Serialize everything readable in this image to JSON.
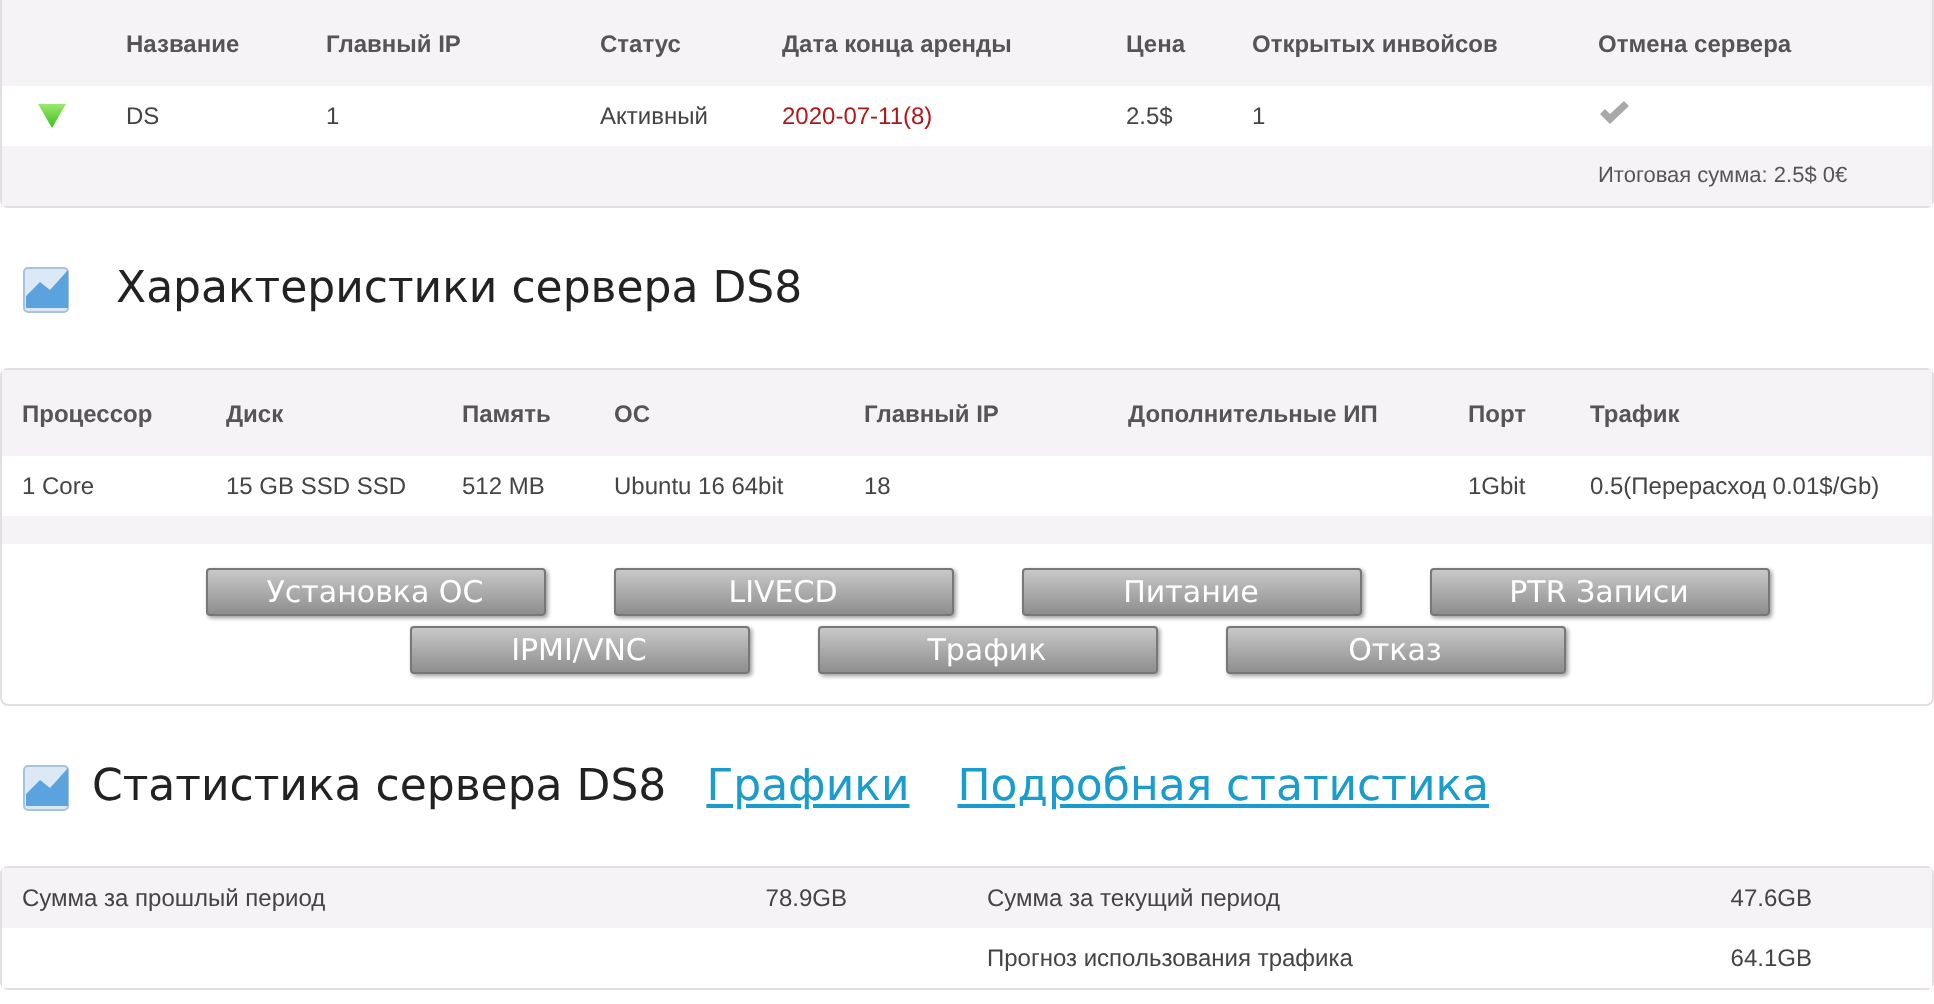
{
  "servers_table": {
    "columns": [
      "Название",
      "Главный IP",
      "Статус",
      "Дата конца аренды",
      "Цена",
      "Открытых инвойсов",
      "Отмена сервера"
    ],
    "rows": [
      {
        "name": "DS",
        "ip": "1",
        "status": "Активный",
        "end_date": "2020-07-11(8)",
        "price": "2.5$",
        "open_invoices": "1"
      }
    ],
    "total": "Итоговая сумма: 2.5$ 0€"
  },
  "specs": {
    "title": "Характеристики сервера DS8",
    "columns": [
      {
        "header": "Процессор",
        "value": "1 Core"
      },
      {
        "header": "Диск",
        "value": "15 GB SSD SSD"
      },
      {
        "header": "Память",
        "value": "512 MB"
      },
      {
        "header": "ОС",
        "value": "Ubuntu 16 64bit"
      },
      {
        "header": "Главный IP",
        "value": "18"
      },
      {
        "header": "Дополнительные ИП"
      },
      {
        "header": "Порт",
        "value": "1Gbit"
      },
      {
        "header": "Трафик",
        "value": "0.5(Перерасход 0.01$/Gb)"
      }
    ]
  },
  "actions": [
    [
      "Установка ОС",
      "LIVECD",
      "Питание",
      "PTR Записи"
    ],
    [
      "IPMI/VNC",
      "Трафик",
      "Отказ"
    ]
  ],
  "stats": {
    "title": "Статистика сервера DS8",
    "links": [
      "Графики",
      "Подробная статистика"
    ],
    "rows": [
      [
        {
          "label": "Сумма за прошлый период",
          "value": "78.9GB"
        },
        {
          "label": "Сумма за текущий период",
          "value": "47.6GB"
        }
      ],
      [
        null,
        {
          "label": "Прогноз использования трафика",
          "value": "64.1GB"
        }
      ]
    ]
  }
}
